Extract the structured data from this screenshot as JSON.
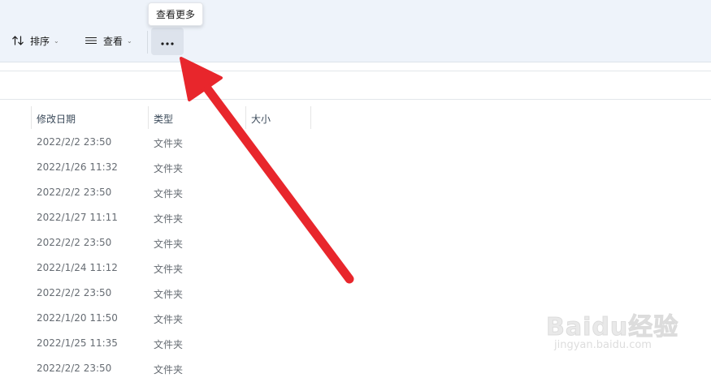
{
  "toolbar": {
    "sort_label": "排序",
    "view_label": "查看",
    "more_tooltip": "查看更多"
  },
  "columns": {
    "modified": "修改日期",
    "type": "类型",
    "size": "大小"
  },
  "rows": [
    {
      "date": "2022/2/2 23:50",
      "type": "文件夹"
    },
    {
      "date": "2022/1/26 11:32",
      "type": "文件夹"
    },
    {
      "date": "2022/2/2 23:50",
      "type": "文件夹"
    },
    {
      "date": "2022/1/27 11:11",
      "type": "文件夹"
    },
    {
      "date": "2022/2/2 23:50",
      "type": "文件夹"
    },
    {
      "date": "2022/1/24 11:12",
      "type": "文件夹"
    },
    {
      "date": "2022/2/2 23:50",
      "type": "文件夹"
    },
    {
      "date": "2022/1/20 11:50",
      "type": "文件夹"
    },
    {
      "date": "2022/1/25 11:35",
      "type": "文件夹"
    },
    {
      "date": "2022/2/2 23:50",
      "type": "文件夹"
    }
  ],
  "watermark": {
    "brand": "Baidu经验",
    "url": "jingyan.baidu.com"
  },
  "colors": {
    "toolbar_bg": "#eef3fa",
    "arrow": "#e8262c",
    "more_button_bg": "#dde3ec"
  },
  "icons": [
    "sort-icon",
    "view-list-icon",
    "more-dots-icon",
    "chevron-down-icon",
    "red-arrow-annotation"
  ]
}
